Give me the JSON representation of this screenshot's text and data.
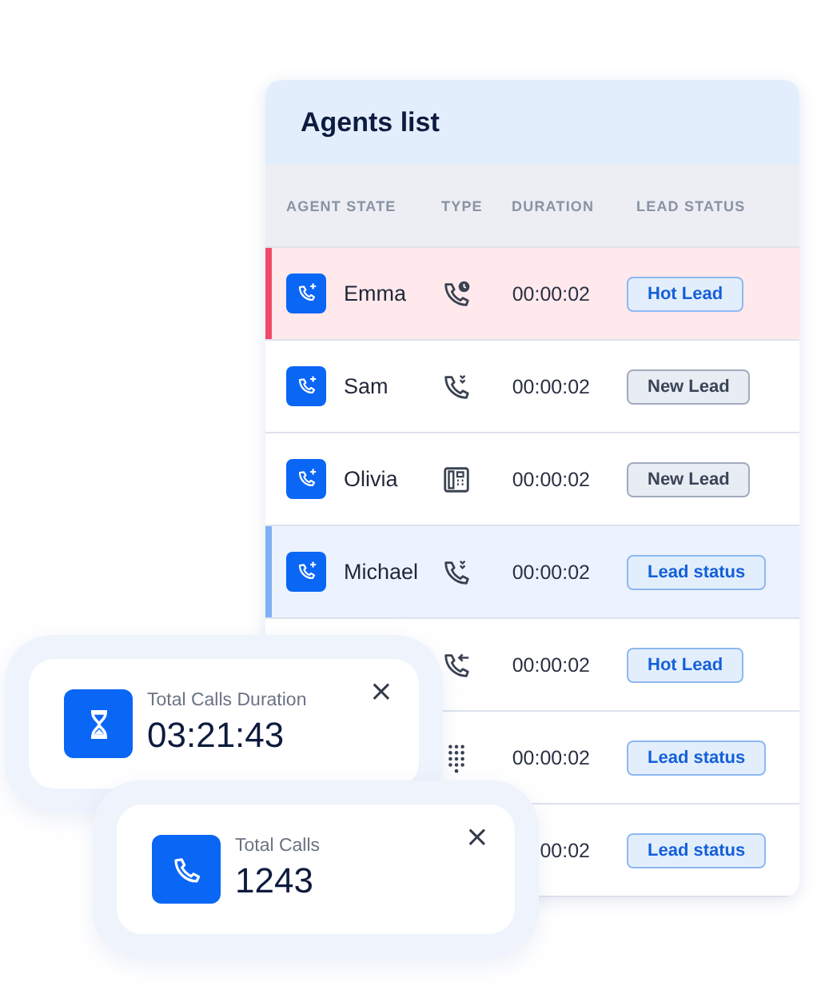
{
  "agents_list": {
    "title": "Agents list",
    "columns": [
      "AGENT STATE",
      "TYPE",
      "DURATION",
      "LEAD STATUS"
    ],
    "rows": [
      {
        "selected": false,
        "color": "#f04a6a",
        "agent": "Emma",
        "kind": "callback",
        "duration": "00:00:02",
        "lead": {
          "label": "Hot Lead",
          "kind": "accent"
        }
      },
      {
        "selected": false,
        "agent": "Sam",
        "kind": "transfer",
        "duration": "00:00:02",
        "lead": {
          "label": "New Lead",
          "kind": "neutral"
        }
      },
      {
        "selected": false,
        "agent": "Olivia",
        "kind": "desk",
        "duration": "00:00:02",
        "lead": {
          "label": "New Lead",
          "kind": "neutral"
        }
      },
      {
        "selected": true,
        "agent": "Michael",
        "kind": "transfer",
        "duration": "00:00:02",
        "lead": {
          "label": "Lead status",
          "kind": "accent"
        }
      },
      {
        "selected": false,
        "kind": "incoming",
        "duration": "00:00:02",
        "lead": {
          "label": "Hot Lead",
          "kind": "accent"
        }
      },
      {
        "selected": false,
        "kind": "keypad",
        "duration": "00:00:02",
        "lead": {
          "label": "Lead status",
          "kind": "accent"
        }
      },
      {
        "selected": false,
        "duration": "00:02",
        "lead": {
          "label": "Lead status",
          "kind": "accent"
        }
      }
    ]
  },
  "stat_cards": [
    {
      "kind": "duration",
      "label": "Total Calls Duration",
      "value": "03:21:43",
      "close": "×"
    },
    {
      "kind": "count",
      "label": "Total Calls",
      "value": "1243",
      "close": "×"
    }
  ]
}
